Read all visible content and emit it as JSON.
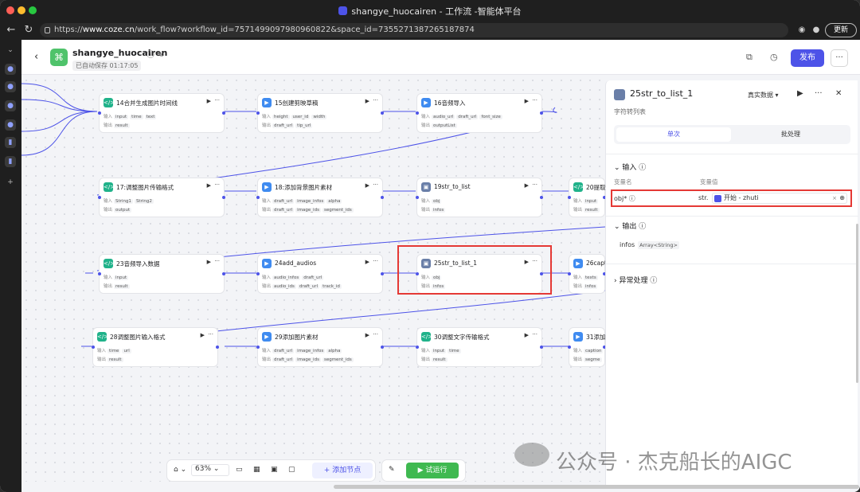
{
  "window": {
    "title": "shangye_huocairen - 工作流 -智能体平台",
    "url_prefix": "https://",
    "url_host": "www.coze.cn",
    "url_path": "/work_flow?workflow_id=7571499097980960822&space_id=7355271387265187874",
    "update_label": "更新"
  },
  "header": {
    "app_name": "shangye_huocairen",
    "autosave": "已自动保存 01:17:05",
    "publish_label": "发布"
  },
  "nodes": [
    {
      "id": "n14",
      "title": "14合并生成图片时间线",
      "icon": "code",
      "in_label": "输入",
      "out_label": "输出",
      "inputs": [
        "input",
        "time",
        "text"
      ],
      "outputs": [
        "result"
      ]
    },
    {
      "id": "n15",
      "title": "15创建剪映草稿",
      "icon": "play",
      "in_label": "输入",
      "out_label": "输出",
      "inputs": [
        "height",
        "user_id",
        "width"
      ],
      "outputs": [
        "draft_url",
        "tip_url"
      ]
    },
    {
      "id": "n16",
      "title": "16音频导入",
      "icon": "play",
      "in_label": "输入",
      "out_label": "输出",
      "inputs": [
        "audio_url",
        "draft_url",
        "font_size"
      ],
      "outputs": [
        "outputList"
      ]
    },
    {
      "id": "n17",
      "title": "17:调整图片传输格式",
      "icon": "code",
      "in_label": "输入",
      "out_label": "输出",
      "inputs": [
        "String1",
        "String2"
      ],
      "outputs": [
        "output"
      ]
    },
    {
      "id": "n18",
      "title": "18:添加背景图片素材",
      "icon": "play",
      "in_label": "输入",
      "out_label": "输出",
      "inputs": [
        "draft_url",
        "image_infos",
        "alpha"
      ],
      "outputs": [
        "draft_url",
        "image_ids",
        "segment_ids"
      ]
    },
    {
      "id": "n19",
      "title": "19str_to_list",
      "icon": "img",
      "in_label": "输入",
      "out_label": "输出",
      "inputs": [
        "obj"
      ],
      "outputs": [
        "infos"
      ]
    },
    {
      "id": "n20",
      "title": "20提取第",
      "icon": "code",
      "in_label": "输入",
      "out_label": "输出",
      "inputs": [
        "input"
      ],
      "outputs": [
        "result"
      ]
    },
    {
      "id": "n23",
      "title": "23音频导入数据",
      "icon": "code",
      "in_label": "输入",
      "out_label": "输出",
      "inputs": [
        "input"
      ],
      "outputs": [
        "result"
      ]
    },
    {
      "id": "n24",
      "title": "24add_audios",
      "icon": "play",
      "in_label": "输入",
      "out_label": "输出",
      "inputs": [
        "audio_infos",
        "draft_url"
      ],
      "outputs": [
        "audio_ids",
        "draft_url",
        "track_id"
      ]
    },
    {
      "id": "n25",
      "title": "25str_to_list_1",
      "icon": "img",
      "in_label": "输入",
      "out_label": "输出",
      "inputs": [
        "obj"
      ],
      "outputs": [
        "infos"
      ]
    },
    {
      "id": "n26",
      "title": "26captio",
      "icon": "play",
      "in_label": "输入",
      "out_label": "输出",
      "inputs": [
        "texts"
      ],
      "outputs": [
        "infos"
      ]
    },
    {
      "id": "n28",
      "title": "28调整图片输入格式",
      "icon": "code",
      "in_label": "输入",
      "out_label": "输出",
      "inputs": [
        "time",
        "url"
      ],
      "outputs": [
        "result"
      ]
    },
    {
      "id": "n29",
      "title": "29添加图片素材",
      "icon": "play",
      "in_label": "输入",
      "out_label": "输出",
      "inputs": [
        "draft_url",
        "image_infos",
        "alpha"
      ],
      "outputs": [
        "draft_url",
        "image_ids",
        "segment_ids"
      ]
    },
    {
      "id": "n30",
      "title": "30调整文字传输格式",
      "icon": "code",
      "in_label": "输入",
      "out_label": "输出",
      "inputs": [
        "input",
        "time"
      ],
      "outputs": [
        "result"
      ]
    },
    {
      "id": "n31",
      "title": "31添加字",
      "icon": "play",
      "in_label": "输入",
      "out_label": "输出",
      "inputs": [
        "caption"
      ],
      "outputs": [
        "segme"
      ]
    }
  ],
  "panel": {
    "title": "25str_to_list_1",
    "mode": "真实数据",
    "description": "字符转列表",
    "tabs": [
      "单次",
      "批处理"
    ],
    "input_section": "输入",
    "col_name": "变量名",
    "col_value": "变量值",
    "var_name": "obj*",
    "var_type": "str.",
    "var_value": "开始 - zhuti",
    "output_section": "输出",
    "output_name": "infos",
    "output_type": "Array<String>",
    "error_section": "异常处理"
  },
  "toolbar": {
    "zoom": "63%",
    "add_node": "添加节点",
    "run": "试运行"
  },
  "watermark": "公众号 · 杰克船长的AIGC",
  "colors": {
    "accent": "#4d53e8",
    "run": "#3fb950",
    "highlight": "#e53935"
  }
}
